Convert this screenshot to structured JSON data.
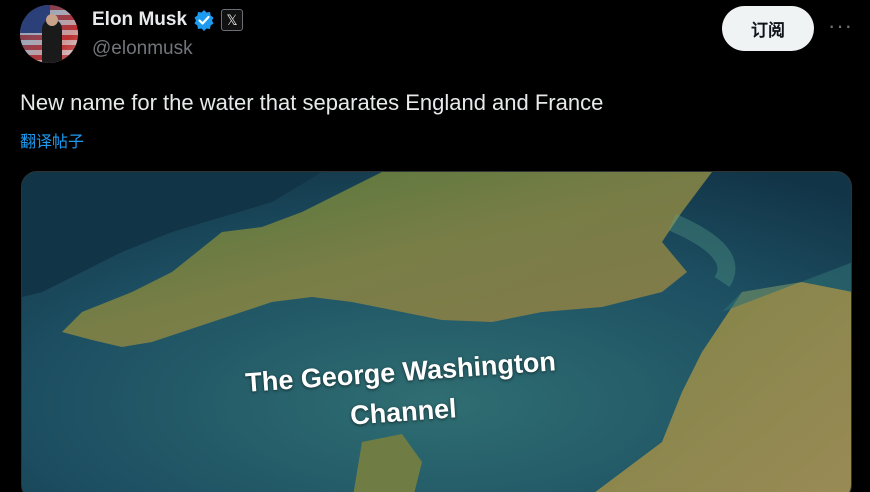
{
  "author": {
    "display_name": "Elon Musk",
    "handle": "@elonmusk",
    "verified": true,
    "affiliation_badge": "𝕏"
  },
  "actions": {
    "subscribe_label": "订阅",
    "more_label": "···"
  },
  "post": {
    "text": "New name for the water that separates England and France",
    "translate_label": "翻译帖子"
  },
  "media": {
    "caption_line1": "The George Washington",
    "caption_line2": "Channel"
  },
  "colors": {
    "background": "#000000",
    "accent_blue": "#1d9bf0",
    "verified_blue": "#1d9bf0",
    "muted_text": "#71767b"
  }
}
